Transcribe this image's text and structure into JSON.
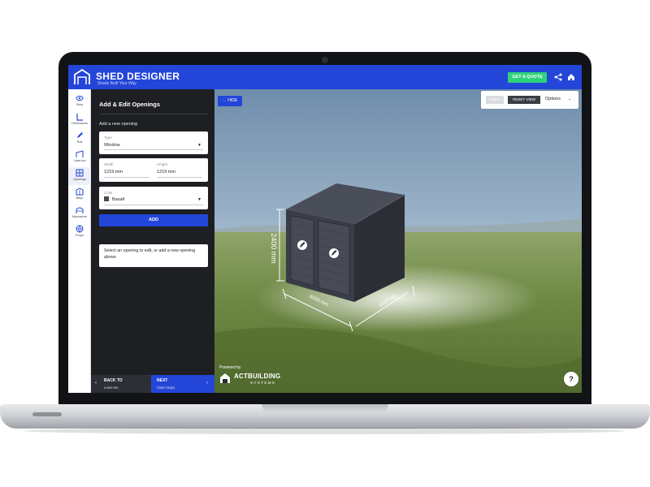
{
  "app": {
    "title": "SHED DESIGNER",
    "tagline": "Sheds Built Your Way",
    "get_quote_label": "GET A QUOTE"
  },
  "rail": {
    "items": [
      {
        "label": "View",
        "icon": "eye-icon"
      },
      {
        "label": "Dimensions",
        "icon": "ruler-icon"
      },
      {
        "label": "Roll",
        "icon": "pencil-icon"
      },
      {
        "label": "Lean-tos",
        "icon": "lean-to-icon"
      },
      {
        "label": "Openings",
        "icon": "window-icon"
      },
      {
        "label": "Bays",
        "icon": "bays-icon"
      },
      {
        "label": "Mezzanine",
        "icon": "mezzanine-icon"
      },
      {
        "label": "Props",
        "icon": "globe-icon"
      }
    ],
    "active_index": 4
  },
  "panel": {
    "title": "Add & Edit Openings",
    "subtitle": "Add a new opening",
    "type_label": "Type",
    "type_value": "Window",
    "width_label": "Width",
    "width_value": "1219 mm",
    "height_label": "Height",
    "height_value": "1219 mm",
    "color_label": "Color",
    "color_value": "Basalt",
    "color_swatch": "#4a4b4d",
    "add_label": "ADD",
    "hint": "Select an opening to edit, or add a new opening above."
  },
  "footer": {
    "back_title": "BACK TO",
    "back_sub": "Lean-tos",
    "next_title": "NEXT",
    "next_sub": "Open Bays"
  },
  "viewport": {
    "hide_label": "← HIDE",
    "undo_label": "UNDO",
    "reset_label": "RESET VIEW",
    "options_label": "Options",
    "height_dimension": "2400 mm",
    "width_dimension": "6000 mm",
    "depth_dimension": "6000 mm",
    "powered_by": "Powered by",
    "brand_name": "ACTBUILDING",
    "brand_sub": "SYSTEMS",
    "help_label": "?"
  },
  "colors": {
    "brand_blue": "#2346d8",
    "quote_green": "#2fd27a",
    "panel_dark": "#1d1f23",
    "shed_steel": "#3a3d47"
  }
}
